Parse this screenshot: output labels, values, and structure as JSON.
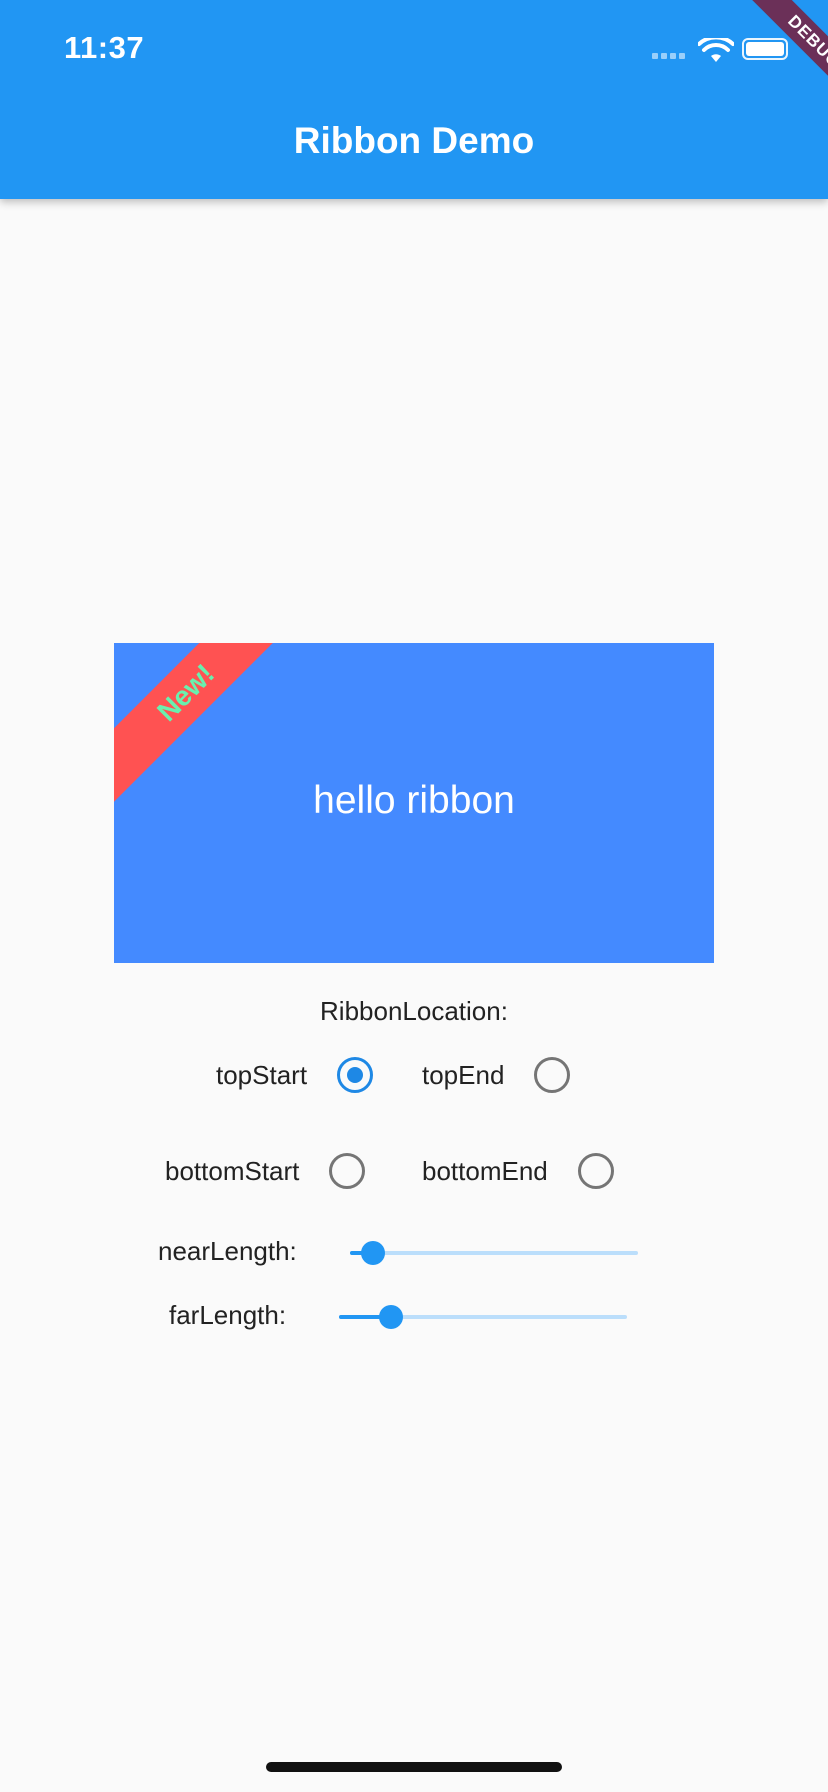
{
  "status_bar": {
    "time": "11:37"
  },
  "app_bar": {
    "title": "Ribbon Demo",
    "color": "#2196f3"
  },
  "debug_banner": {
    "label": "DEBUG"
  },
  "card": {
    "text": "hello ribbon",
    "ribbon_label": "New!",
    "card_color": "#448aff",
    "ribbon_color": "#ff5252",
    "ribbon_text_color": "#69f0ae"
  },
  "ribbon_location": {
    "label": "RibbonLocation:",
    "options": [
      {
        "label": "topStart",
        "selected": true
      },
      {
        "label": "topEnd",
        "selected": false
      },
      {
        "label": "bottomStart",
        "selected": false
      },
      {
        "label": "bottomEnd",
        "selected": false
      }
    ]
  },
  "sliders": {
    "near_length": {
      "label": "nearLength:",
      "fraction": 0.08
    },
    "far_length": {
      "label": "farLength:",
      "fraction": 0.18
    }
  }
}
